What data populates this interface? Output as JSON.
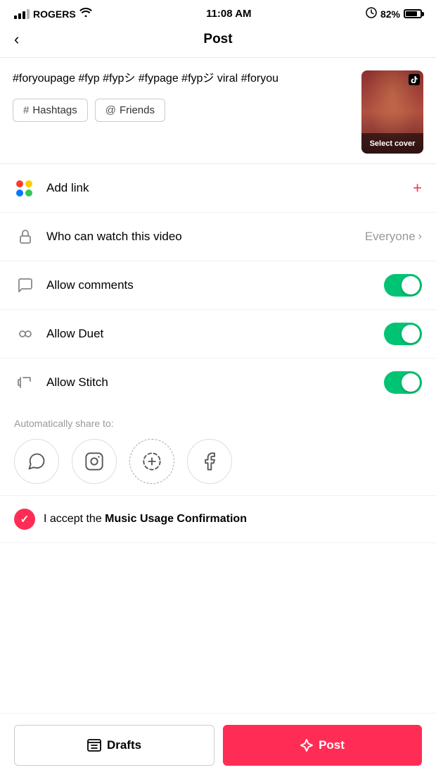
{
  "statusBar": {
    "carrier": "ROGERS",
    "time": "11:08 AM",
    "battery": "82%"
  },
  "nav": {
    "back_label": "<",
    "title": "Post"
  },
  "caption": {
    "text": "#foryoupage #fyp #fypシ #fypage\n#fypジ viral #foryou",
    "hashtags_btn": "# Hashtags",
    "friends_btn": "@ Friends",
    "video_overlay": "Select cover"
  },
  "addLink": {
    "label": "Add link",
    "icon": "plus"
  },
  "whoCanWatch": {
    "label": "Who can watch this video",
    "value": "Everyone",
    "chevron": ">"
  },
  "allowComments": {
    "label": "Allow comments",
    "enabled": true
  },
  "allowDuet": {
    "label": "Allow Duet",
    "enabled": true
  },
  "allowStitch": {
    "label": "Allow Stitch",
    "enabled": true
  },
  "shareSection": {
    "label": "Automatically share to:"
  },
  "shareIcons": [
    {
      "name": "whatsapp",
      "symbol": "💬"
    },
    {
      "name": "instagram",
      "symbol": "📷"
    },
    {
      "name": "tiktok-add",
      "symbol": "⊕"
    },
    {
      "name": "facebook",
      "symbol": "f"
    }
  ],
  "musicRow": {
    "prefix": "I accept the ",
    "bold": "Music Usage Confirmation"
  },
  "bottomBar": {
    "drafts_icon": "⊟",
    "drafts_label": "Drafts",
    "post_icon": "✳",
    "post_label": "Post"
  }
}
